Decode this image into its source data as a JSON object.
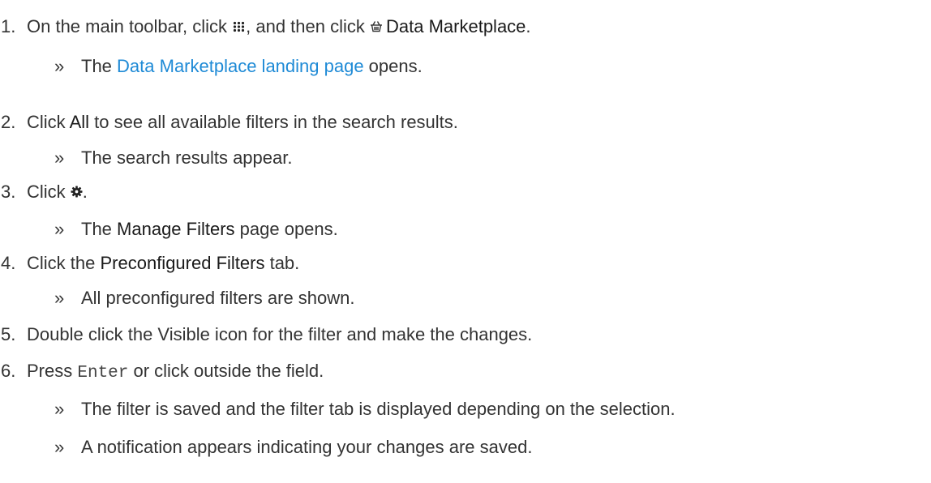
{
  "steps": [
    {
      "number": "1.",
      "parts": {
        "t1": "On the main toolbar, click ",
        "t2": ", and then click ",
        "ui": "Data Marketplace",
        "t3": "."
      },
      "result": {
        "t1": "The ",
        "link": "Data Marketplace landing page",
        "t2": " opens."
      }
    },
    {
      "number": "2.",
      "parts": {
        "t1": "Click ",
        "ui": "All",
        "t2": " to see all available filters in the search results."
      },
      "result": {
        "t1": "The search results appear."
      }
    },
    {
      "number": "3.",
      "parts": {
        "t1": "Click ",
        "t2": "."
      },
      "result": {
        "t1": "The ",
        "ui": "Manage Filters",
        "t2": " page opens."
      }
    },
    {
      "number": "4.",
      "parts": {
        "t1": "Click the ",
        "ui": "Preconfigured Filters",
        "t2": " tab."
      },
      "result": {
        "t1": "All preconfigured filters are shown."
      }
    },
    {
      "number": "5.",
      "parts": {
        "t1": "Double click the Visible icon for the filter and make the changes."
      }
    },
    {
      "number": "6.",
      "parts": {
        "t1": "Press ",
        "code": "Enter",
        "t2": " or click outside the field."
      },
      "results": [
        {
          "t1": "The filter is saved and the filter tab is displayed depending on the selection."
        },
        {
          "t1": "A notification appears indicating your changes are saved."
        }
      ]
    }
  ],
  "result_marker": "»",
  "icons": [
    "apps-dots-icon",
    "basket-icon",
    "gear-icon"
  ],
  "colors": {
    "text": "#333333",
    "link": "#1e8ad6",
    "ui_text": "#1a1a1a"
  }
}
